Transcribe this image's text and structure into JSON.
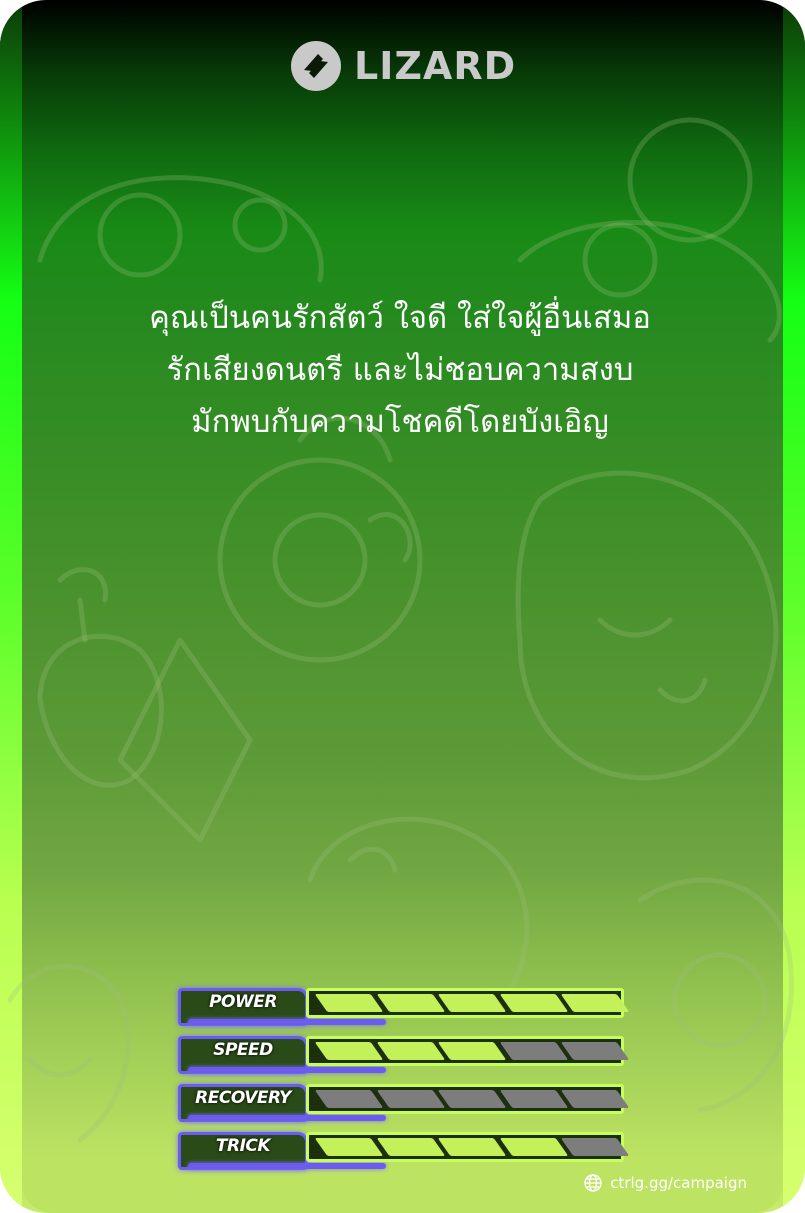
{
  "brand": {
    "name": "LIZARD",
    "logo_icon": "lizard-logo-icon",
    "logo_color": "#c9c9c9"
  },
  "description": {
    "lines": [
      "คุณเป็นคนรักสัตว์ ใจดี ใส่ใจผู้อื่นเสมอ",
      "รักเสียงดนตรี และไม่ชอบความสงบ",
      "มักพบกับความโชคดีโดยบังเอิญ"
    ]
  },
  "stats": [
    {
      "label": "POWER",
      "filled": 5,
      "total": 5
    },
    {
      "label": "SPEED",
      "filled": 3,
      "total": 5
    },
    {
      "label": "RECOVERY",
      "filled": 0,
      "total": 5
    },
    {
      "label": "TRICK",
      "filled": 4,
      "total": 5
    }
  ],
  "footer": {
    "url": "ctrlg.gg/campaign",
    "url_icon": "globe-icon"
  },
  "colors": {
    "bar_fill": "#c4f15a",
    "bar_empty": "#7d7d7d",
    "label_border": "#6b5cf0",
    "edge_glow": "#14ff14"
  }
}
